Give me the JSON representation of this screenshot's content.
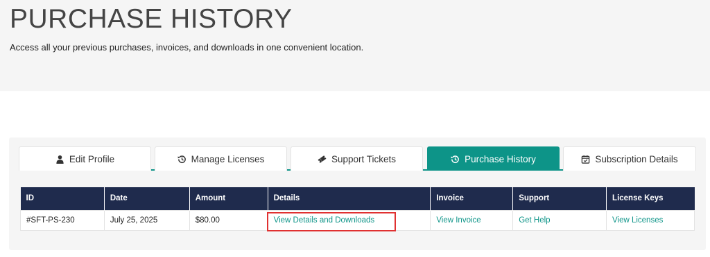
{
  "header": {
    "title": "PURCHASE HISTORY",
    "subtitle": "Access all your previous purchases, invoices, and downloads in one convenient location."
  },
  "tabs": [
    {
      "label": "Edit Profile",
      "icon": "user-icon",
      "active": false
    },
    {
      "label": "Manage Licenses",
      "icon": "history-icon",
      "active": false
    },
    {
      "label": "Support Tickets",
      "icon": "ticket-icon",
      "active": false
    },
    {
      "label": "Purchase History",
      "icon": "history-icon",
      "active": true
    },
    {
      "label": "Subscription Details",
      "icon": "calendar-check-icon",
      "active": false
    }
  ],
  "table": {
    "headers": [
      "ID",
      "Date",
      "Amount",
      "Details",
      "Invoice",
      "Support",
      "License Keys"
    ],
    "rows": [
      {
        "id": "#SFT-PS-230",
        "date": "July 25, 2025",
        "amount": "$80.00",
        "details": "View Details and Downloads",
        "invoice": "View Invoice",
        "support": "Get Help",
        "license_keys": "View Licenses"
      }
    ]
  },
  "colors": {
    "accent": "#0d9488",
    "table_header": "#1f2b4d",
    "highlight": "#e03131"
  }
}
